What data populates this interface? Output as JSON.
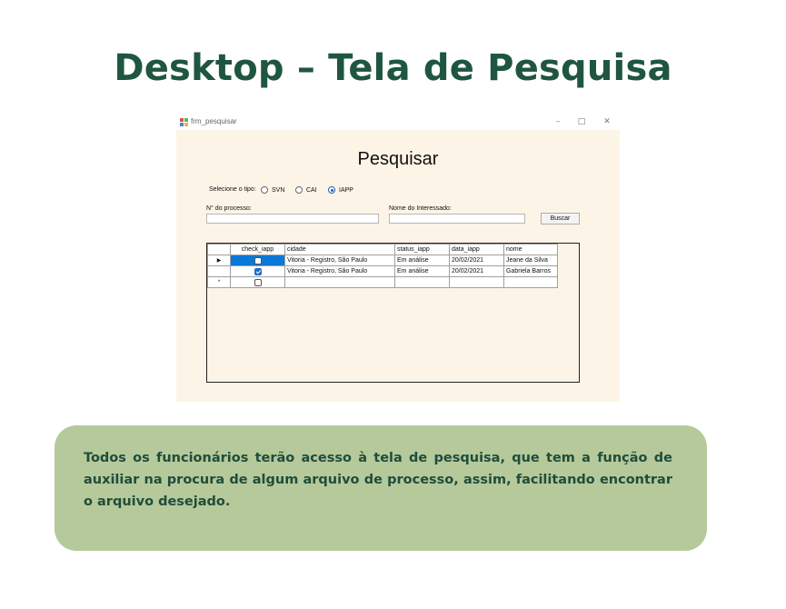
{
  "page": {
    "title": "Desktop – Tela de Pesquisa",
    "description": " Todos os funcionários terão acesso à tela de pesquisa, que tem a função de auxiliar na procura de algum arquivo de processo, assim, facilitando encontrar o arquivo desejado."
  },
  "window": {
    "title": "frm_pesquisar",
    "minimize_glyph": "–",
    "maximize_glyph": "□",
    "close_glyph": "✕",
    "icon": "app-grid-icon"
  },
  "form": {
    "heading": "Pesquisar",
    "type_label": "Selecione o tipo:",
    "radio_options": [
      {
        "label": "SVN",
        "selected": false
      },
      {
        "label": "CAI",
        "selected": false
      },
      {
        "label": "IAPP",
        "selected": true
      }
    ],
    "process_number_label": "N° do processo:",
    "process_number_value": "",
    "interested_name_label": "Nome do Interessado:",
    "interested_name_value": "",
    "search_button": "Buscar"
  },
  "grid": {
    "columns": [
      "check_iapp",
      "cidade",
      "status_iapp",
      "data_iapp",
      "nome"
    ],
    "rows": [
      {
        "indicator": "▶",
        "checked": false,
        "cidade": "Vitoria - Registro, São Paulo",
        "status": "Em análise",
        "data": "20/02/2021",
        "nome": "Jeane da Silva"
      },
      {
        "indicator": "",
        "checked": true,
        "cidade": "Vitoria - Registro, São Paulo",
        "status": "Em análise",
        "data": "20/02/2021",
        "nome": "Gabriela Barros"
      },
      {
        "indicator": "*",
        "checked": false,
        "cidade": "",
        "status": "",
        "data": "",
        "nome": ""
      }
    ]
  },
  "colors": {
    "title_green": "#1f5640",
    "form_background": "#fcf4e6",
    "info_box_background": "#b6c99b",
    "selection_blue": "#0a78d7"
  }
}
